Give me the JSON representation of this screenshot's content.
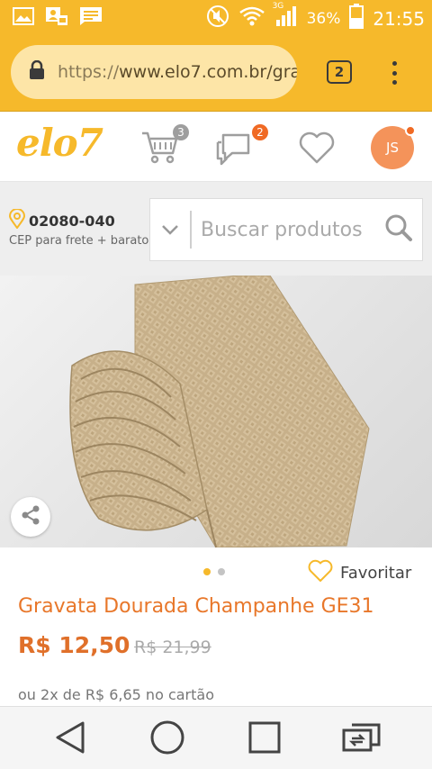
{
  "status_bar": {
    "network": "3G",
    "battery": "36%",
    "time": "21:55"
  },
  "browser": {
    "url_scheme": "https://",
    "url_host": "www.elo7.com.br/gra",
    "tab_count": "2"
  },
  "header": {
    "logo": "elo7",
    "cart_count": "3",
    "messages_count": "2",
    "avatar_initials": "JS"
  },
  "location": {
    "cep": "02080-040",
    "subtitle": "CEP para frete + barato"
  },
  "search": {
    "placeholder": "Buscar produtos"
  },
  "product": {
    "favorite_label": "Favoritar",
    "title": "Gravata Dourada Champanhe GE31",
    "price": "R$ 12,50",
    "old_price": "R$ 21,99",
    "installments": "ou 2x de R$ 6,65 no cartão",
    "image_index": 1,
    "image_count": 2
  },
  "colors": {
    "brand_yellow": "#f6b92b",
    "accent_orange": "#e8772a",
    "badge_gray": "#9e9e9e",
    "badge_orange": "#f06a24"
  }
}
